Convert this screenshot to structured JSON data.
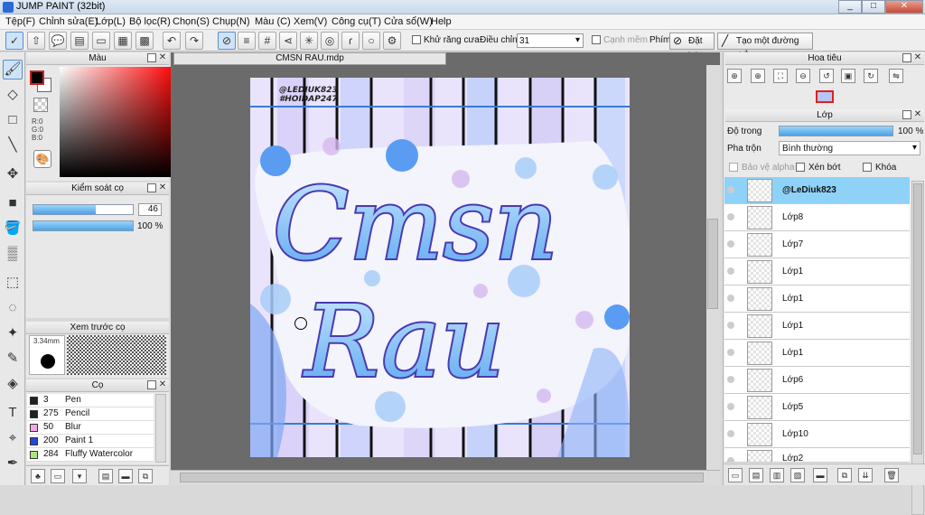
{
  "window": {
    "title": "JUMP PAINT (32bit)",
    "min": "_",
    "max": "□",
    "close": "✕"
  },
  "menu": [
    "Tệp(F)",
    "Chỉnh sửa(E)",
    "Lớp(L)",
    "Bộ lọc(R)",
    "Chọn(S)",
    "Chụp(N)",
    "Màu (C)",
    "Xem(V)",
    "Công cụ(T)",
    "Cửa sổ(W)",
    "Help"
  ],
  "toolbar": {
    "antialias_label": "Khử răng cưa",
    "adjust_label": "Điều chỉnh",
    "adjust_value": "31",
    "snap_label": "Cạnh mềm",
    "shortcut_label": "Phím",
    "reset_label": "Đặt lại",
    "straight_label": "Tạo một đường thẳng"
  },
  "color_panel": {
    "title": "Màu",
    "r": "R:0",
    "g": "G:0",
    "b": "B:0",
    "foreground": "#000000",
    "background": "#ffffff"
  },
  "brush_control": {
    "title": "Kiểm soát cọ",
    "size_value": "46",
    "size_fraction": 0.63,
    "opacity_value": "100 %",
    "opacity_fraction": 1.0
  },
  "brush_preview": {
    "title": "Xem trước cọ",
    "size": "3.34mm"
  },
  "brush_list": {
    "title": "Cọ",
    "items": [
      {
        "size": "3",
        "name": "Pen",
        "color": "#222222"
      },
      {
        "size": "275",
        "name": "Pencil",
        "color": "#222222"
      },
      {
        "size": "50",
        "name": "Blur",
        "color": "#f4a8e8"
      },
      {
        "size": "200",
        "name": "Paint 1",
        "color": "#2446d8"
      },
      {
        "size": "284",
        "name": "Fluffy Watercolor",
        "color": "#a8e87a"
      }
    ]
  },
  "document": {
    "tab": "CMSN RAU.mdp",
    "watermark_1": "@LEDIUK823",
    "watermark_2": "#HOIDAP247",
    "main_text_1": "Cmsn",
    "main_text_2": "Rau"
  },
  "navigator": {
    "title": "Hoa tiêu"
  },
  "layers": {
    "title": "Lớp",
    "opacity_label": "Độ trong",
    "opacity_value": "100 %",
    "opacity_fraction": 1.0,
    "blend_label": "Pha trộn",
    "blend_value": "Bình thường",
    "protect_alpha": "Bảo vệ alpha",
    "clipping": "Xén bớt",
    "lock": "Khóa",
    "items": [
      {
        "name": "@LeDiuk823",
        "selected": true
      },
      {
        "name": "Lớp8"
      },
      {
        "name": "Lớp7"
      },
      {
        "name": "Lớp1"
      },
      {
        "name": "Lớp1"
      },
      {
        "name": "Lớp1"
      },
      {
        "name": "Lớp1"
      },
      {
        "name": "Lớp6"
      },
      {
        "name": "Lớp5"
      },
      {
        "name": "Lớp10"
      },
      {
        "name": "Lớp2"
      }
    ]
  }
}
